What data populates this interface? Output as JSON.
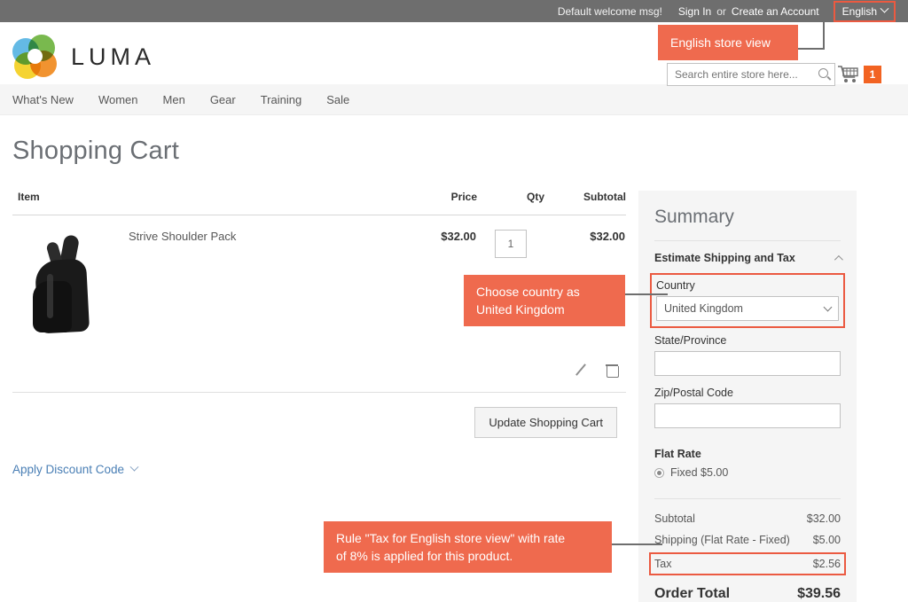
{
  "topbar": {
    "welcome": "Default welcome msg!",
    "sign_in": "Sign In",
    "or": "or",
    "create_account": "Create an Account",
    "language": "English",
    "chevron_icon": "chevron-down-icon",
    "highlight_color": "#eb5a41"
  },
  "header": {
    "logo_text": "LUMA",
    "logo_icon": "luma-flower-logo",
    "search_placeholder": "Search entire store here...",
    "search_value": "",
    "search_icon": "search-icon",
    "cart_icon": "shopping-cart-icon",
    "cart_count": "1",
    "cart_badge_color": "#f26322"
  },
  "nav": {
    "items": [
      {
        "label": "What's New"
      },
      {
        "label": "Women"
      },
      {
        "label": "Men"
      },
      {
        "label": "Gear"
      },
      {
        "label": "Training"
      },
      {
        "label": "Sale"
      }
    ]
  },
  "page": {
    "title": "Shopping Cart"
  },
  "cart": {
    "columns": {
      "item": "Item",
      "price": "Price",
      "qty": "Qty",
      "subtotal": "Subtotal"
    },
    "rows": [
      {
        "name": "Strive Shoulder Pack",
        "image_alt": "black-sling-backpack",
        "price": "$32.00",
        "qty": "1",
        "subtotal": "$32.00"
      }
    ],
    "edit_icon": "pencil-icon",
    "delete_icon": "trash-icon",
    "update_button": "Update Shopping Cart",
    "discount_link": "Apply Discount Code",
    "discount_chevron_icon": "chevron-down-icon"
  },
  "summary": {
    "title": "Summary",
    "estimate_section": "Estimate Shipping and Tax",
    "estimate_chevron_icon": "chevron-up-icon",
    "country_label": "Country",
    "country_value": "United Kingdom",
    "country_chevron_icon": "chevron-down-icon",
    "state_label": "State/Province",
    "state_value": "",
    "zip_label": "Zip/Postal Code",
    "zip_value": "",
    "flat_rate_heading": "Flat Rate",
    "flat_rate_option": "Fixed $5.00",
    "totals": [
      {
        "label": "Subtotal",
        "value": "$32.00",
        "highlight": false
      },
      {
        "label": "Shipping (Flat Rate - Fixed)",
        "value": "$5.00",
        "highlight": false
      },
      {
        "label": "Tax",
        "value": "$2.56",
        "highlight": true
      }
    ],
    "order_total_label": "Order Total",
    "order_total_value": "$39.56"
  },
  "annotations": {
    "color": "#ef6a4e",
    "callout_store_view": "English store view",
    "callout_country": "Choose country as\nUnited Kingdom",
    "callout_country_line1": "Choose country as",
    "callout_country_line2": "United Kingdom",
    "callout_tax_line1": "Rule \"Tax for English store view\" with rate",
    "callout_tax_line2": "of 8% is applied for this product."
  }
}
